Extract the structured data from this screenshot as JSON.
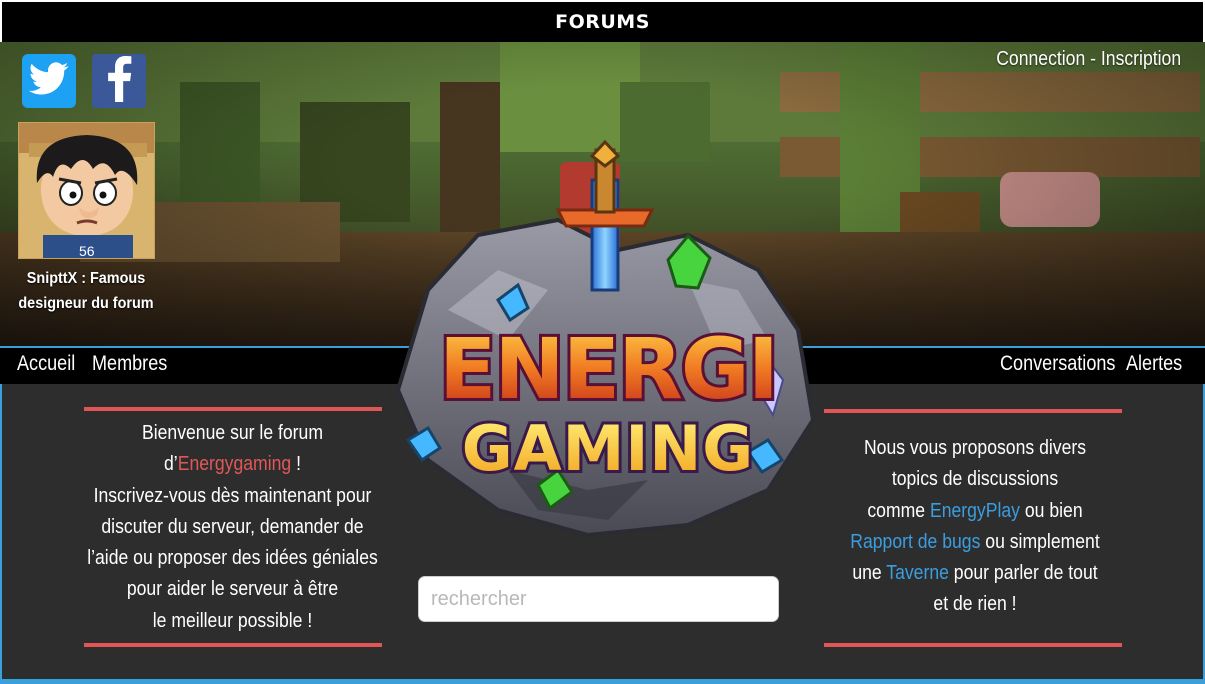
{
  "header": {
    "title": "FORUMS"
  },
  "auth": {
    "connection": "Connection",
    "separator": " - ",
    "inscription": "Inscription"
  },
  "social": {
    "twitter_icon": "twitter-icon",
    "facebook_icon": "facebook-icon"
  },
  "profile": {
    "caption_line1": "SnipttX : Famous",
    "caption_line2": "designeur du forum"
  },
  "nav": {
    "left": [
      "Accueil",
      "Membres"
    ],
    "right": [
      "Conversations",
      "Alertes"
    ]
  },
  "logo": {
    "line1": "ENERGI",
    "line2": "GAMING"
  },
  "welcome": {
    "line1": "Bienvenue sur le forum",
    "line2_prefix": "d’",
    "brand": "Energygaming",
    "line2_suffix": " !",
    "line3": "Inscrivez-vous dès maintenant pour",
    "line4": "discuter du serveur, demander de",
    "line5": "l’aide ou proposer des idées géniales",
    "line6": "pour aider le serveur à être",
    "line7": "le meilleur possible !"
  },
  "topics": {
    "line1": "Nous vous proposons divers",
    "line2": "topics de discussions",
    "line3_prefix": "comme ",
    "link1": "EnergyPlay",
    "line3_suffix": " ou bien",
    "link2": "Rapport de bugs",
    "line4_suffix": " ou simplement",
    "line5_prefix": "une ",
    "link3": "Taverne",
    "line5_suffix": " pour parler de tout",
    "line6": "et de rien !"
  },
  "search": {
    "placeholder": "rechercher"
  },
  "colors": {
    "accent_red": "#e05555",
    "accent_blue": "#3a9ee0",
    "panel_bg": "#2e2d2d"
  }
}
